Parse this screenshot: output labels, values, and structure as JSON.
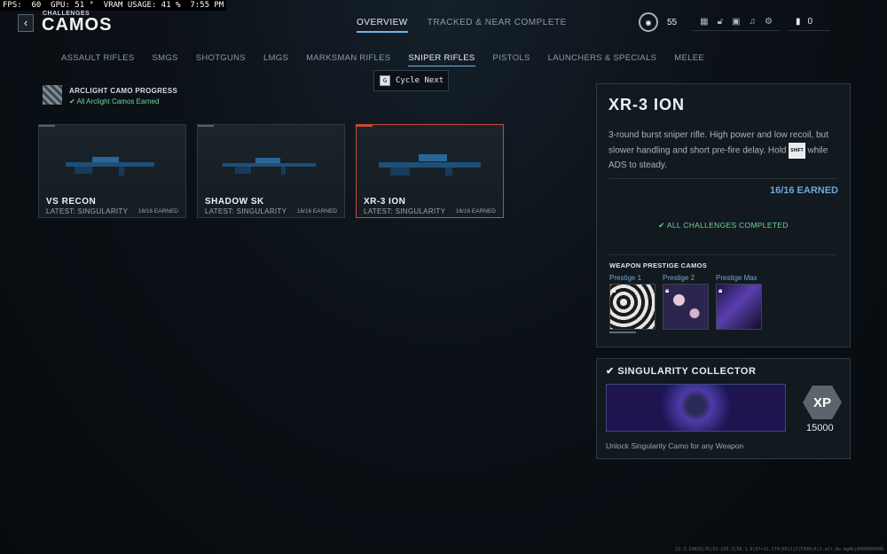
{
  "perf_overlay": "FPS:  60  GPU: 51 °  VRAM USAGE: 41 %  7:55 PM",
  "header": {
    "back_icon": "chevron-left-icon",
    "breadcrumb": "CHALLENGES",
    "title": "CAMOS",
    "tabs": [
      {
        "label": "OVERVIEW",
        "active": true
      },
      {
        "label": "TRACKED & NEAR COMPLETE",
        "active": false
      }
    ],
    "level": "55",
    "currency": "0",
    "hud_icons": [
      "grid-icon",
      "unlock-icon",
      "camera-icon",
      "bell-icon",
      "gear-icon"
    ]
  },
  "categories": [
    {
      "label": "ASSAULT RIFLES",
      "active": false
    },
    {
      "label": "SMGS",
      "active": false
    },
    {
      "label": "SHOTGUNS",
      "active": false
    },
    {
      "label": "LMGS",
      "active": false
    },
    {
      "label": "MARKSMAN RIFLES",
      "active": false
    },
    {
      "label": "SNIPER RIFLES",
      "active": true
    },
    {
      "label": "PISTOLS",
      "active": false
    },
    {
      "label": "LAUNCHERS & SPECIALS",
      "active": false
    },
    {
      "label": "MELEE",
      "active": false
    }
  ],
  "cycle_tip": {
    "key": "G",
    "label": "Cycle Next"
  },
  "arclight": {
    "title": "ARCLIGHT CAMO PROGRESS",
    "status": "✔ All Arclight Camos Earned"
  },
  "weapons": [
    {
      "name": "VS RECON",
      "latest": "LATEST: SINGULARITY",
      "earned": "16/16 EARNED",
      "selected": false
    },
    {
      "name": "SHADOW SK",
      "latest": "LATEST: SINGULARITY",
      "earned": "16/16 EARNED",
      "selected": false
    },
    {
      "name": "XR-3 ION",
      "latest": "LATEST: SINGULARITY",
      "earned": "16/16 EARNED",
      "selected": true
    }
  ],
  "detail": {
    "title": "XR-3 ION",
    "desc_before": "3-round burst sniper rifle. High power and low recoil, but slower handling and short pre-fire delay. Hold ",
    "shift_key": "SHIFT",
    "desc_after": " while ADS to steady.",
    "earned": "16/16 EARNED",
    "completed": "✔ ALL CHALLENGES COMPLETED",
    "prestige_heading": "WEAPON PRESTIGE CAMOS",
    "prestige": [
      {
        "label": "Prestige 1"
      },
      {
        "label": "Prestige 2"
      },
      {
        "label": "Prestige Max"
      }
    ]
  },
  "reward": {
    "title": "✔ SINGULARITY COLLECTOR",
    "xp_label": "XP",
    "xp_amount": "15000",
    "desc": "Unlock Singularity Camo for any Weapon"
  },
  "build_string": "12.3.24826|35|52-125.1|50.1.0|67+11.174|00|1|2|F300|6|1.all.0w.mg4k|0000000000"
}
